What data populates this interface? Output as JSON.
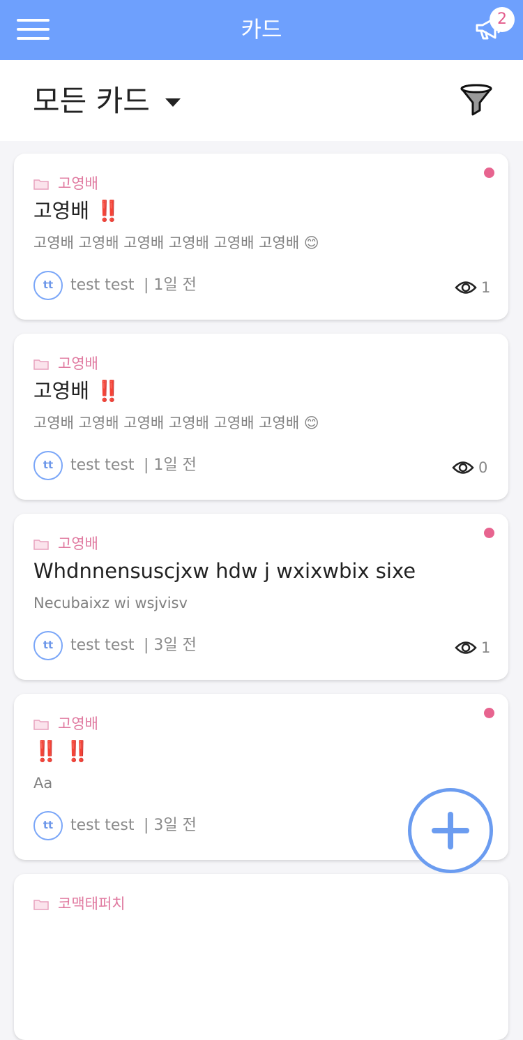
{
  "header": {
    "title": "카드",
    "notice_count": "2"
  },
  "filter": {
    "title": "모든 카드"
  },
  "cards": [
    {
      "category": "고영배",
      "title": "고영배 ‼️",
      "body": "고영배 고영배 고영배 고영배 고영배 고영배 😊",
      "avatar": "tt",
      "author": "test test",
      "time": "| 1일 전",
      "views": "1",
      "unread": true
    },
    {
      "category": "고영배",
      "title": "고영배 ‼️",
      "body": "고영배 고영배 고영배 고영배 고영배 고영배 😊",
      "avatar": "tt",
      "author": "test test",
      "time": "| 1일 전",
      "views": "0",
      "unread": false
    },
    {
      "category": "고영배",
      "title": "Whdnnensuscjxw hdw j wxixwbix sixe",
      "body": "Necubaixz wi wsjvisv",
      "avatar": "tt",
      "author": "test test",
      "time": "| 3일 전",
      "views": "1",
      "unread": true
    },
    {
      "category": "고영배",
      "title": "‼️ ‼️",
      "body": "Aa",
      "avatar": "tt",
      "author": "test test",
      "time": "| 3일 전",
      "views": "",
      "unread": true
    }
  ],
  "partial_card": {
    "category": "코맥태퍼치"
  },
  "icons": {
    "menu": "hamburger-menu-icon",
    "notice": "megaphone-icon",
    "caret": "caret-down-icon",
    "filter": "funnel-icon",
    "folder": "folder-icon",
    "views": "eye-icon",
    "add": "plus-icon"
  },
  "colors": {
    "appbar": "#6ea0fd",
    "accent_pink": "#e07aa0",
    "unread_dot": "#e7648f",
    "avatar_blue": "#7aa6f8"
  }
}
